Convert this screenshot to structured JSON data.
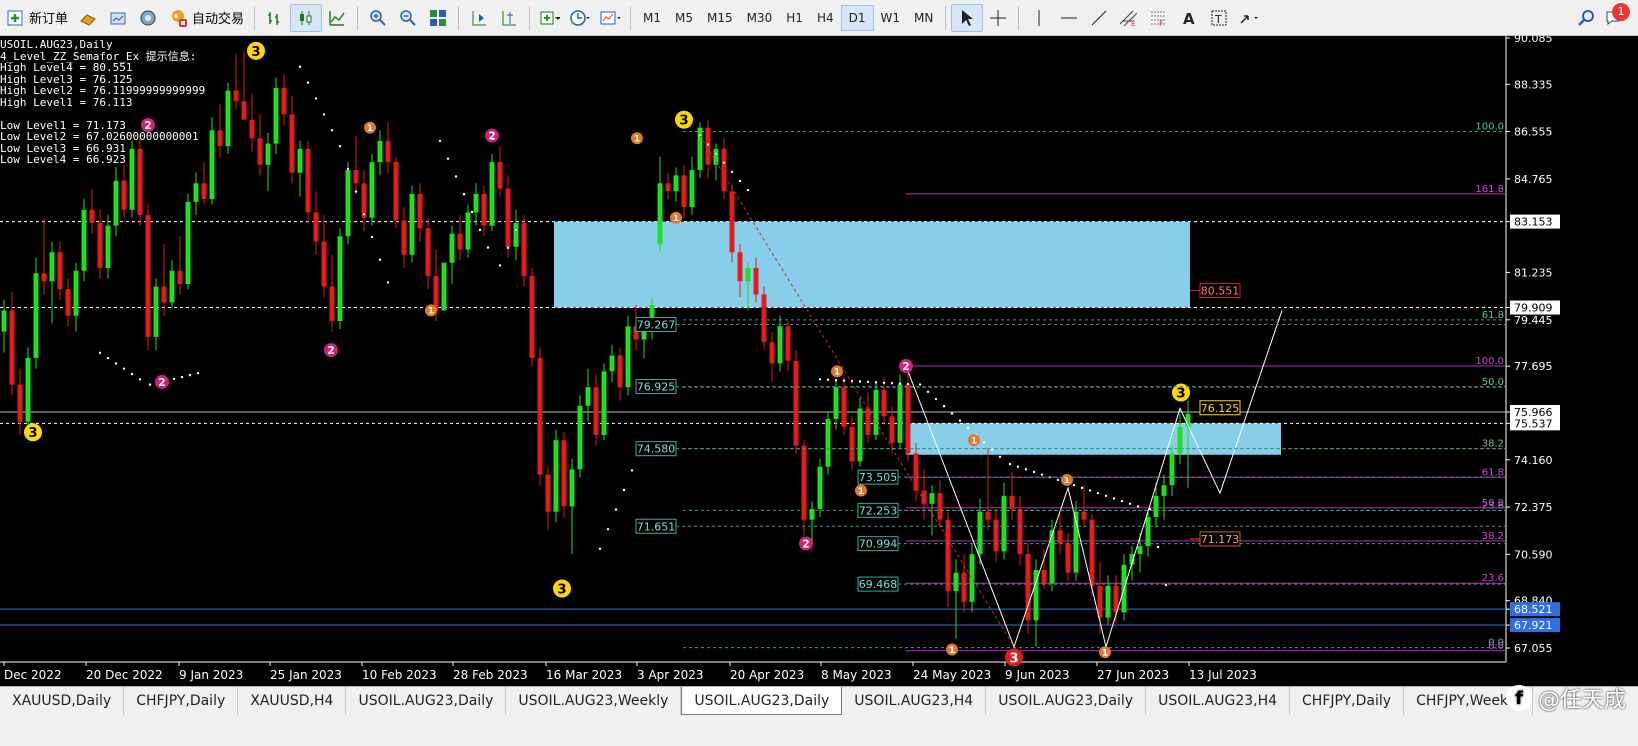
{
  "toolbar": {
    "new_order": "新订单",
    "auto_trade": "自动交易",
    "timeframes": [
      "M1",
      "M5",
      "M15",
      "M30",
      "H1",
      "H4",
      "D1",
      "W1",
      "MN"
    ],
    "active_timeframe": "D1",
    "notification_count": "1"
  },
  "info": {
    "symbol": "USOIL.AUG23,Daily",
    "indicator": "4_Level_ZZ_Semafor_Ex 提示信息:",
    "lines": [
      "High Level4 = 80.551",
      "High Level3 = 76.125",
      "High Level2 = 76.11999999999999",
      "High Level1 = 76.113",
      "",
      "Low Level1 = 71.173",
      "Low Level2 = 67.02600000000001",
      "Low Level3 = 66.931",
      "Low Level4 = 66.923"
    ]
  },
  "price_axis": [
    "90.085",
    "88.335",
    "86.555",
    "84.765",
    "83.153",
    "81.235",
    "79.909",
    "79.445",
    "77.695",
    "75.966",
    "75.537",
    "74.160",
    "72.375",
    "70.590",
    "68.840",
    "68.521",
    "67.921",
    "67.055"
  ],
  "date_axis": [
    "Dec 2022",
    "20 Dec 2022",
    "9 Jan 2023",
    "25 Jan 2023",
    "10 Feb 2023",
    "28 Feb 2023",
    "16 Mar 2023",
    "3 Apr 2023",
    "20 Apr 2023",
    "8 May 2023",
    "24 May 2023",
    "9 Jun 2023",
    "27 Jun 2023",
    "13 Jul 2023"
  ],
  "price_boxes": [
    "79.267",
    "76.925",
    "74.580",
    "71.651",
    "73.505",
    "72.253",
    "70.994",
    "69.468",
    "80.551",
    "76.125",
    "71.173"
  ],
  "fib_labels": [
    "100.0",
    "161.8",
    "61.8",
    "100.0",
    "50.0",
    "38.2",
    "61.8",
    "50.0",
    "23.6",
    "38.2",
    "23.6",
    "0.0"
  ],
  "semafor_labels": [
    "3",
    "2",
    "1"
  ],
  "chart_data": {
    "type": "candlestick",
    "symbol": "USOIL.AUG23",
    "timeframe": "Daily",
    "ylim": [
      67.055,
      90.085
    ],
    "horizontal_levels": [
      83.153,
      79.909,
      75.966,
      75.537,
      68.521,
      67.921
    ],
    "ohlc": [
      [
        79.0,
        80.2,
        78.2,
        79.8
      ],
      [
        79.8,
        80.5,
        76.6,
        77.0
      ],
      [
        77.0,
        77.6,
        75.1,
        75.6
      ],
      [
        75.6,
        78.4,
        75.3,
        78.0
      ],
      [
        78.0,
        81.8,
        77.6,
        81.2
      ],
      [
        81.2,
        83.3,
        80.4,
        80.9
      ],
      [
        80.9,
        82.4,
        79.3,
        82.0
      ],
      [
        82.0,
        82.4,
        80.2,
        80.6
      ],
      [
        80.6,
        81.0,
        79.2,
        79.6
      ],
      [
        79.6,
        81.6,
        79.0,
        81.3
      ],
      [
        81.3,
        84.0,
        80.9,
        83.6
      ],
      [
        83.6,
        84.4,
        82.7,
        83.1
      ],
      [
        83.1,
        83.6,
        81.0,
        81.4
      ],
      [
        81.4,
        83.4,
        81.0,
        83.0
      ],
      [
        83.0,
        85.2,
        82.6,
        84.7
      ],
      [
        84.7,
        85.3,
        83.3,
        83.6
      ],
      [
        83.6,
        86.2,
        83.3,
        85.9
      ],
      [
        85.9,
        86.4,
        83.0,
        83.4
      ],
      [
        83.4,
        83.8,
        78.3,
        78.8
      ],
      [
        78.8,
        81.0,
        78.3,
        80.7
      ],
      [
        80.7,
        82.3,
        79.6,
        80.1
      ],
      [
        80.1,
        81.7,
        79.9,
        81.3
      ],
      [
        81.3,
        82.6,
        80.4,
        80.8
      ],
      [
        80.8,
        84.2,
        80.6,
        83.9
      ],
      [
        83.9,
        85.0,
        83.4,
        84.6
      ],
      [
        84.6,
        85.4,
        83.8,
        84.0
      ],
      [
        84.0,
        87.1,
        83.8,
        86.6
      ],
      [
        86.6,
        87.6,
        85.6,
        86.0
      ],
      [
        86.0,
        88.4,
        85.7,
        88.1
      ],
      [
        88.1,
        89.5,
        87.4,
        87.7
      ],
      [
        87.7,
        89.6,
        87.3,
        87.0
      ],
      [
        87.0,
        88.0,
        85.8,
        86.3
      ],
      [
        86.3,
        87.2,
        84.9,
        85.3
      ],
      [
        85.3,
        86.5,
        84.3,
        86.1
      ],
      [
        86.1,
        88.6,
        85.7,
        88.2
      ],
      [
        88.2,
        88.7,
        86.8,
        87.2
      ],
      [
        87.2,
        87.9,
        84.6,
        85.0
      ],
      [
        85.0,
        86.2,
        84.1,
        85.9
      ],
      [
        85.9,
        86.2,
        83.1,
        83.5
      ],
      [
        83.5,
        84.3,
        81.9,
        82.4
      ],
      [
        82.4,
        83.4,
        80.3,
        80.7
      ],
      [
        80.7,
        81.9,
        79.0,
        79.4
      ],
      [
        79.4,
        82.9,
        79.1,
        82.6
      ],
      [
        82.6,
        85.4,
        82.3,
        85.1
      ],
      [
        85.1,
        86.4,
        84.2,
        84.6
      ],
      [
        84.6,
        85.1,
        82.8,
        83.3
      ],
      [
        83.3,
        85.7,
        83.0,
        85.4
      ],
      [
        85.4,
        86.6,
        84.9,
        86.2
      ],
      [
        86.2,
        86.9,
        85.0,
        85.4
      ],
      [
        85.4,
        85.6,
        82.9,
        83.2
      ],
      [
        83.2,
        83.7,
        81.4,
        81.9
      ],
      [
        81.9,
        84.5,
        81.6,
        84.2
      ],
      [
        84.2,
        84.6,
        82.4,
        82.9
      ],
      [
        82.9,
        83.3,
        80.6,
        81.1
      ],
      [
        81.1,
        82.1,
        79.4,
        79.8
      ],
      [
        79.8,
        80.1,
        80.2,
        81.6
      ],
      [
        81.6,
        83.0,
        80.8,
        82.7
      ],
      [
        82.7,
        83.4,
        81.7,
        82.1
      ],
      [
        82.1,
        83.8,
        81.8,
        83.5
      ],
      [
        83.5,
        84.6,
        83.0,
        84.2
      ],
      [
        84.2,
        84.5,
        82.6,
        83.0
      ],
      [
        83.0,
        85.7,
        82.8,
        85.4
      ],
      [
        85.4,
        86.0,
        84.1,
        84.4
      ],
      [
        84.4,
        84.9,
        81.8,
        82.2
      ],
      [
        82.2,
        83.6,
        81.7,
        83.1
      ],
      [
        83.1,
        83.4,
        80.7,
        81.1
      ],
      [
        81.1,
        81.4,
        77.7,
        78.0
      ],
      [
        78.0,
        78.4,
        73.2,
        73.6
      ],
      [
        73.6,
        73.9,
        71.5,
        72.2
      ],
      [
        72.2,
        75.3,
        71.8,
        74.9
      ],
      [
        74.9,
        75.2,
        72.0,
        72.4
      ],
      [
        72.4,
        74.2,
        70.6,
        73.8
      ],
      [
        73.8,
        76.6,
        73.5,
        76.2
      ],
      [
        76.2,
        77.6,
        75.6,
        76.9
      ],
      [
        76.9,
        77.4,
        74.7,
        75.1
      ],
      [
        75.1,
        77.8,
        74.9,
        77.5
      ],
      [
        77.5,
        78.5,
        77.1,
        78.1
      ],
      [
        78.1,
        78.4,
        76.4,
        76.9
      ],
      [
        76.9,
        79.6,
        76.6,
        79.2
      ],
      [
        79.2,
        80.0,
        78.3,
        78.7
      ],
      [
        78.7,
        79.5,
        78.0,
        79.1
      ],
      [
        79.1,
        80.3,
        78.7,
        80.0
      ],
      [
        82.3,
        85.6,
        82.0,
        84.6
      ],
      [
        84.6,
        85.0,
        84.0,
        84.3
      ],
      [
        84.3,
        85.2,
        83.9,
        84.9
      ],
      [
        84.9,
        85.3,
        83.3,
        83.7
      ],
      [
        83.7,
        85.6,
        83.4,
        85.1
      ],
      [
        85.1,
        86.9,
        84.8,
        86.7
      ],
      [
        86.7,
        87.0,
        84.8,
        85.3
      ],
      [
        85.3,
        86.1,
        84.7,
        85.9
      ],
      [
        85.9,
        86.3,
        84.0,
        84.3
      ],
      [
        84.3,
        84.6,
        81.6,
        82.0
      ],
      [
        82.0,
        82.3,
        80.3,
        80.9
      ],
      [
        80.9,
        81.6,
        79.8,
        81.4
      ],
      [
        81.4,
        81.8,
        80.1,
        80.4
      ],
      [
        80.4,
        80.7,
        78.3,
        78.6
      ],
      [
        78.6,
        79.0,
        77.1,
        77.8
      ],
      [
        77.8,
        79.6,
        77.5,
        79.2
      ],
      [
        79.2,
        79.4,
        77.5,
        77.9
      ],
      [
        77.9,
        78.3,
        74.4,
        74.7
      ],
      [
        74.7,
        74.9,
        71.3,
        71.9
      ],
      [
        71.9,
        72.6,
        71.0,
        72.3
      ],
      [
        72.3,
        74.2,
        72.0,
        73.9
      ],
      [
        73.9,
        76.0,
        73.6,
        75.7
      ],
      [
        75.7,
        77.2,
        75.3,
        76.9
      ],
      [
        76.9,
        77.3,
        75.1,
        75.4
      ],
      [
        75.4,
        75.8,
        73.8,
        74.1
      ],
      [
        74.1,
        76.5,
        73.9,
        76.1
      ],
      [
        76.1,
        76.7,
        74.8,
        75.1
      ],
      [
        75.1,
        77.1,
        74.9,
        76.8
      ],
      [
        76.8,
        77.3,
        75.5,
        75.8
      ],
      [
        75.8,
        76.2,
        74.4,
        74.8
      ],
      [
        74.8,
        77.4,
        74.6,
        77.0
      ],
      [
        77.0,
        77.7,
        74.1,
        74.4
      ],
      [
        74.4,
        74.8,
        72.6,
        73.0
      ],
      [
        73.0,
        73.8,
        71.9,
        72.5
      ],
      [
        72.5,
        73.2,
        71.3,
        72.9
      ],
      [
        72.9,
        73.4,
        71.6,
        71.9
      ],
      [
        71.9,
        72.2,
        68.6,
        69.2
      ],
      [
        69.2,
        70.4,
        67.4,
        69.9
      ],
      [
        69.9,
        70.6,
        68.4,
        68.8
      ],
      [
        68.8,
        71.0,
        68.4,
        70.6
      ],
      [
        70.6,
        72.7,
        70.2,
        72.2
      ],
      [
        72.2,
        74.6,
        71.5,
        71.9
      ],
      [
        71.9,
        72.3,
        70.3,
        70.7
      ],
      [
        70.7,
        73.3,
        70.4,
        72.8
      ],
      [
        72.8,
        73.7,
        71.9,
        72.3
      ],
      [
        72.3,
        72.8,
        70.2,
        70.6
      ],
      [
        70.6,
        71.0,
        67.6,
        68.1
      ],
      [
        68.1,
        70.4,
        67.1,
        70.0
      ],
      [
        70.0,
        70.8,
        69.3,
        69.5
      ],
      [
        69.5,
        71.9,
        69.2,
        71.5
      ],
      [
        71.5,
        72.1,
        70.6,
        71.0
      ],
      [
        71.0,
        71.4,
        69.6,
        69.9
      ],
      [
        69.9,
        72.6,
        69.6,
        72.2
      ],
      [
        72.2,
        73.2,
        71.6,
        71.9
      ],
      [
        71.9,
        72.1,
        69.0,
        69.4
      ],
      [
        69.4,
        70.3,
        67.6,
        68.2
      ],
      [
        68.2,
        69.8,
        67.9,
        69.4
      ],
      [
        69.4,
        69.8,
        68.0,
        68.4
      ],
      [
        68.4,
        70.6,
        68.1,
        70.2
      ],
      [
        70.2,
        70.9,
        69.6,
        70.6
      ],
      [
        70.6,
        71.4,
        69.9,
        70.9
      ],
      [
        70.9,
        72.3,
        70.5,
        72.0
      ],
      [
        72.0,
        73.3,
        71.6,
        72.8
      ],
      [
        72.8,
        73.6,
        71.9,
        73.2
      ],
      [
        73.2,
        74.7,
        72.8,
        74.4
      ],
      [
        74.4,
        75.9,
        74.0,
        75.4
      ],
      [
        75.4,
        76.4,
        73.1,
        75.9
      ]
    ]
  }
}
